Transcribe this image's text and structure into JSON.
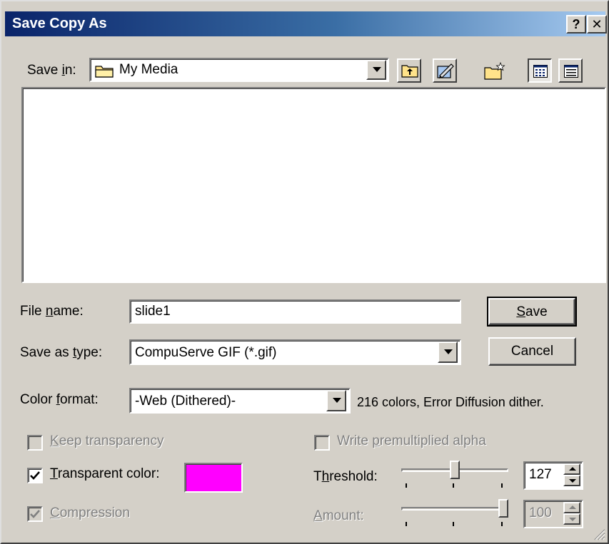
{
  "window": {
    "title": "Save Copy As",
    "help_label": "?",
    "close_label": "✕"
  },
  "save_in": {
    "label_pre": "Save ",
    "label_key": "i",
    "label_post": "n:",
    "value": "My Media",
    "icon": "folder-icon"
  },
  "toolbar": {
    "icons": [
      "up-one-level-icon",
      "web-folder-icon",
      "new-folder-icon",
      "list-view-icon",
      "details-view-icon"
    ]
  },
  "file_name": {
    "label_pre": "File ",
    "label_key": "n",
    "label_post": "ame:",
    "value": "slide1"
  },
  "save_as_type": {
    "label_pre": "Save as ",
    "label_key": "t",
    "label_post": "ype:",
    "value": "CompuServe GIF (*.gif)"
  },
  "buttons": {
    "save_key": "S",
    "save_rest": "ave",
    "cancel": "Cancel"
  },
  "color_format": {
    "label_pre": "Color ",
    "label_key": "f",
    "label_post": "ormat:",
    "value": "-Web (Dithered)-",
    "description": "216 colors, Error Diffusion dither."
  },
  "options": {
    "keep_transparency": {
      "key": "K",
      "rest": "eep transparency",
      "checked": false,
      "enabled": false
    },
    "write_premultiplied": {
      "pre": "Write ",
      "key": "p",
      "rest": "remultiplied alpha",
      "checked": false,
      "enabled": false
    },
    "transparent_color": {
      "key": "T",
      "rest": "ransparent color:",
      "checked": true,
      "enabled": true,
      "color": "#ff00ff"
    },
    "compression": {
      "key": "C",
      "rest": "ompression",
      "checked": true,
      "enabled": false
    }
  },
  "threshold": {
    "pre": "T",
    "key": "h",
    "rest": "reshold:",
    "value": "127",
    "level": 127,
    "max": 255
  },
  "amount": {
    "key": "A",
    "rest": "mount:",
    "value": "100",
    "level": 100,
    "max": 100
  }
}
